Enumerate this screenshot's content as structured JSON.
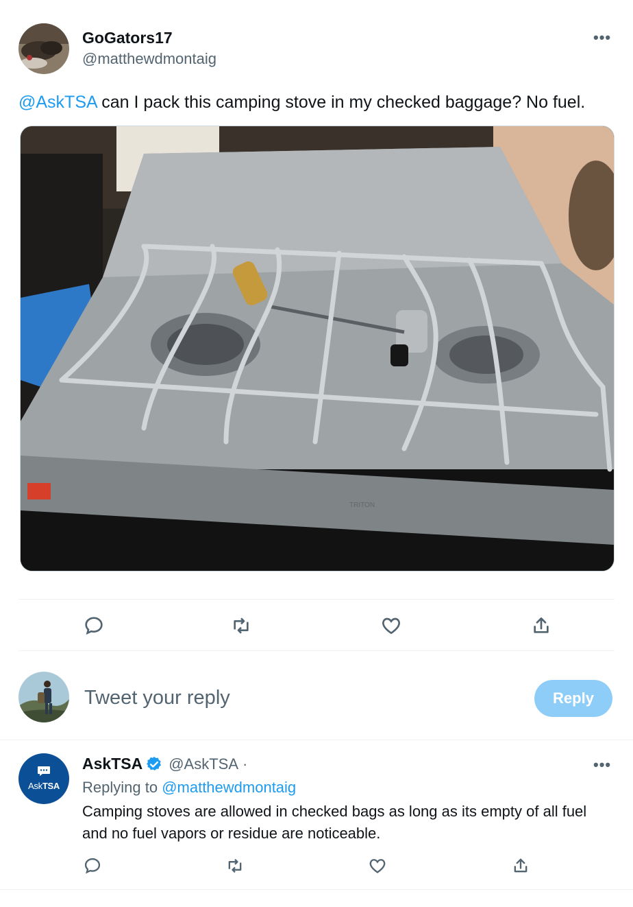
{
  "tweet": {
    "author_name": "GoGators17",
    "author_handle": "@matthewdmontaig",
    "text_mention": "@AskTSA",
    "text_body": " can I pack this camping stove in my checked baggage? No fuel.",
    "more_label": "•••",
    "media": {
      "description_icon": "camping-stove-photo"
    },
    "actions": [
      "reply-icon",
      "retweet-icon",
      "like-icon",
      "share-icon"
    ]
  },
  "composer": {
    "placeholder": "Tweet your reply",
    "reply_button": "Reply"
  },
  "reply": {
    "author_name": "AskTSA",
    "verified_icon": "verified-badge-icon",
    "author_handle": "@AskTSA",
    "separator": "·",
    "replying_prefix": "Replying to ",
    "replying_handle": "@matthewdmontaig",
    "avatar_label_a": "Ask",
    "avatar_label_b": "TSA",
    "text": "Camping stoves are allowed in checked bags as long as its empty of all fuel and no fuel vapors or residue are noticeable.",
    "more_label": "•••",
    "actions": [
      "reply-icon",
      "retweet-icon",
      "like-icon",
      "share-icon"
    ]
  },
  "colors": {
    "link": "#1d9bf0",
    "secondary_text": "#536471",
    "reply_button_bg": "#8ecdf8",
    "tsa_avatar_bg": "#0b4f96"
  }
}
